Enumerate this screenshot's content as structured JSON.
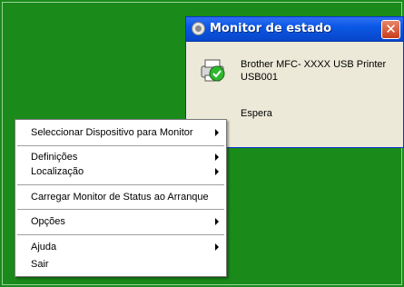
{
  "monitor_window": {
    "title": "Monitor de estado",
    "close_glyph": "✕",
    "device_line1": "Brother MFC- XXXX  USB Printer",
    "device_line2": "USB001",
    "status_text": "Espera",
    "title_icon": "status-monitor-icon",
    "printer_icon": "printer-check-icon",
    "colors": {
      "titlebar": "#0a58e6",
      "close": "#c83d1a",
      "desktop": "#1a8a1a"
    }
  },
  "context_menu": {
    "items": [
      {
        "label": "Seleccionar Dispositivo para Monitor",
        "submenu": true
      },
      {
        "label": "Definições",
        "submenu": true
      },
      {
        "label": "Localização",
        "submenu": true
      },
      {
        "label": "Carregar Monitor de Status ao Arranque",
        "submenu": false
      },
      {
        "label": "Opções",
        "submenu": true
      },
      {
        "label": "Ajuda",
        "submenu": true
      },
      {
        "label": "Sair",
        "submenu": false
      }
    ]
  }
}
